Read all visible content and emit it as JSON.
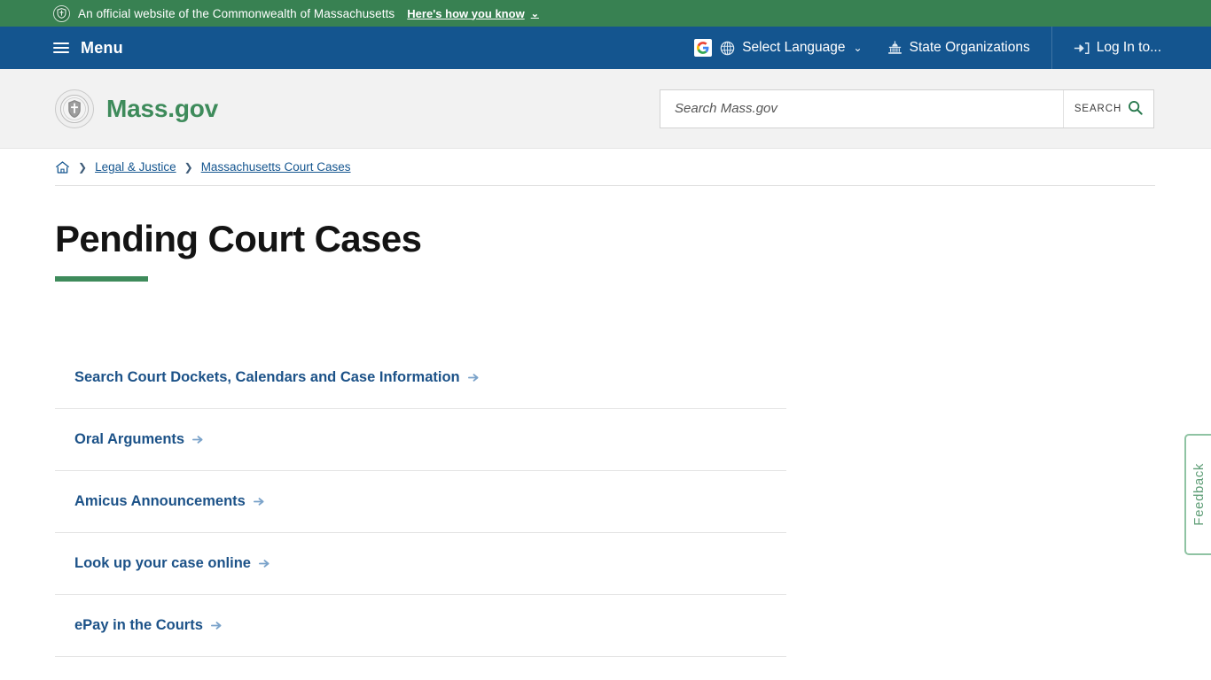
{
  "gov_banner": {
    "text": "An official website of the Commonwealth of Massachusetts",
    "link_label": "Here's how you know",
    "chevron": "⌄",
    "shield_icon": "shield-icon",
    "background": "#388152"
  },
  "topnav": {
    "menu_label": "Menu",
    "background": "#14558f",
    "items": [
      {
        "label": "Select Language",
        "icon": "globe-icon",
        "has_google_badge": true,
        "chevron": "⌄"
      },
      {
        "label": "State Organizations",
        "icon": "capitol-building-icon"
      },
      {
        "label": "Log In to...",
        "icon": "login-arrow-icon"
      }
    ]
  },
  "site_header": {
    "brand_name": "Mass.gov",
    "brand_color": "#3e8b5b",
    "seal_icon": "massachusetts-seal-icon",
    "background": "#f2f2f2"
  },
  "search": {
    "placeholder": "Search Mass.gov",
    "value": "",
    "button_label": "SEARCH",
    "button_icon": "magnifier-icon",
    "accent": "#2a7a4f"
  },
  "breadcrumb": {
    "home_icon": "home-icon",
    "separator": "❯",
    "items": [
      {
        "label": "Legal & Justice"
      },
      {
        "label": "Massachusetts Court Cases"
      }
    ]
  },
  "page": {
    "title": "Pending Court Cases",
    "rule_color": "#3e8b5b"
  },
  "links": {
    "arrow_icon": "arrow-right-icon",
    "items": [
      {
        "label": "Search Court Dockets, Calendars and Case Information"
      },
      {
        "label": "Oral Arguments"
      },
      {
        "label": "Amicus Announcements"
      },
      {
        "label": "Look up your case online"
      },
      {
        "label": "ePay in the Courts"
      }
    ]
  },
  "feedback": {
    "label": "Feedback",
    "border_color": "#8fc3a3",
    "text_color": "#5f9e77"
  }
}
